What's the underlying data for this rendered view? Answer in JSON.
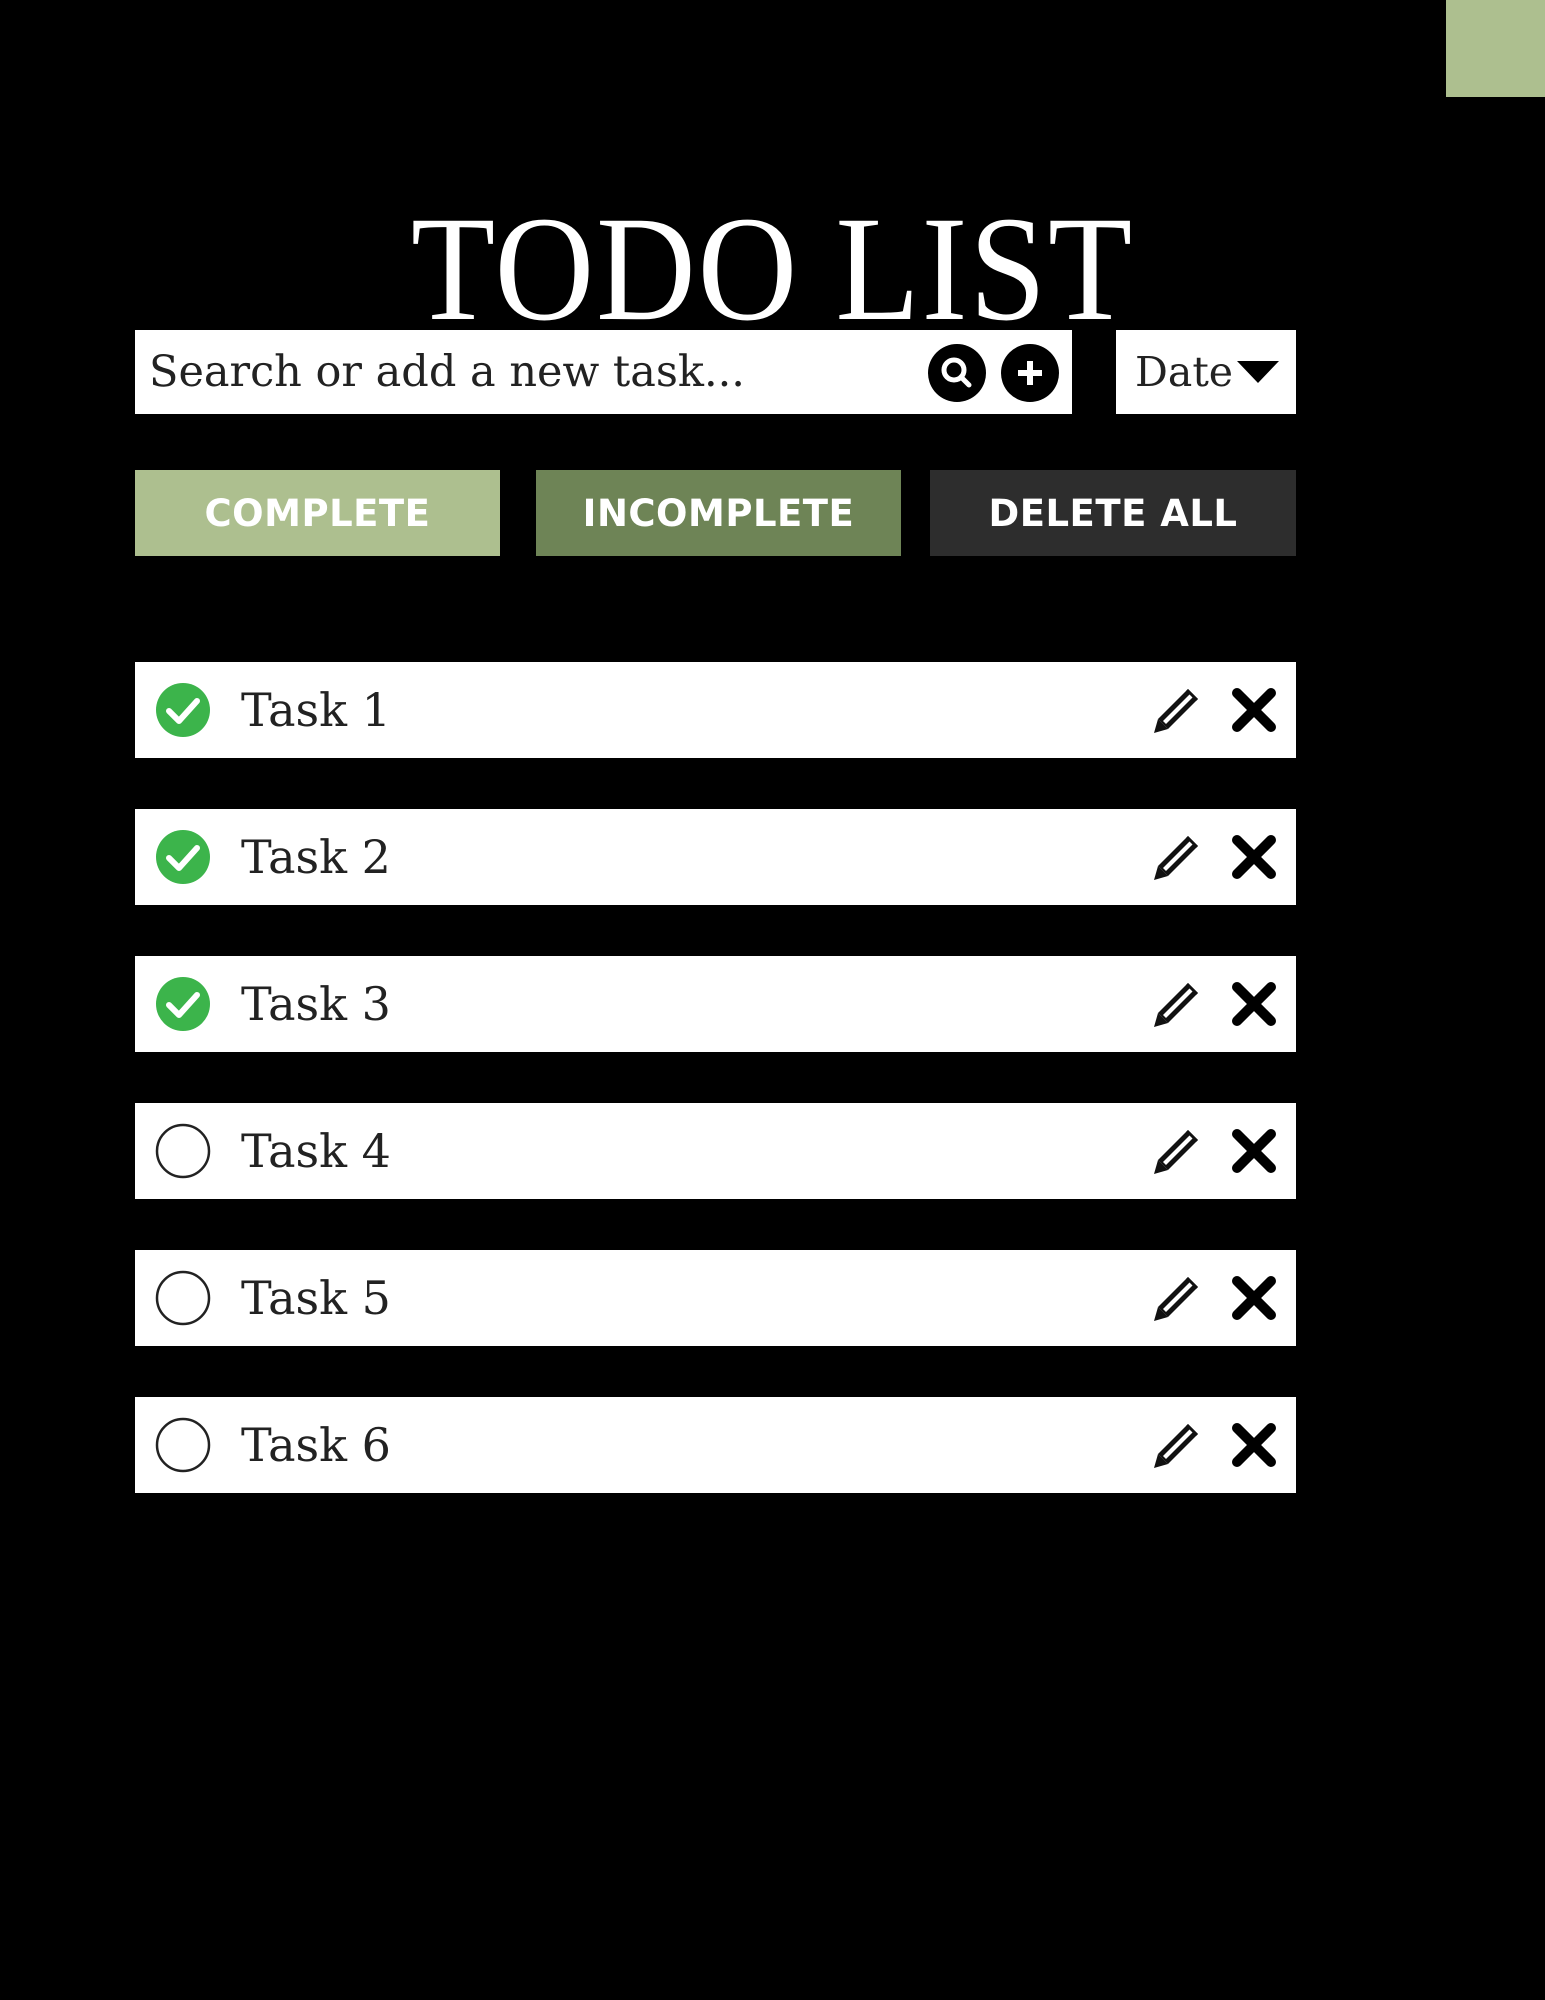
{
  "app": {
    "title": "TODO LIST"
  },
  "colors": {
    "background": "#000000",
    "accent_light": "#adbf8f",
    "accent_dark": "#6e8456",
    "delete_button": "#2d2d2d",
    "check_green": "#3cb44b"
  },
  "search": {
    "placeholder": "Search or add a new task...",
    "value": "",
    "search_icon": "search-icon",
    "add_icon": "plus-circle-icon"
  },
  "sort": {
    "selected": "Date",
    "icon": "caret-down-icon"
  },
  "filters": {
    "complete_label": "COMPLETE",
    "incomplete_label": "INCOMPLETE",
    "delete_all_label": "DELETE ALL"
  },
  "tasks": [
    {
      "label": "Task 1",
      "completed": true
    },
    {
      "label": "Task 2",
      "completed": true
    },
    {
      "label": "Task 3",
      "completed": true
    },
    {
      "label": "Task 4",
      "completed": false
    },
    {
      "label": "Task 5",
      "completed": false
    },
    {
      "label": "Task 6",
      "completed": false
    }
  ],
  "task_icons": {
    "edit": "pencil-icon",
    "delete": "x-icon",
    "done": "check-circle-icon",
    "todo": "empty-circle-icon"
  }
}
